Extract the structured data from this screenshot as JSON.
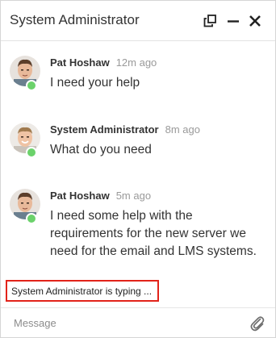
{
  "header": {
    "title": "System Administrator",
    "icons": [
      "popout-icon",
      "minimize-icon",
      "close-icon"
    ]
  },
  "messages": [
    {
      "sender": "Pat Hoshaw",
      "time": "12m ago",
      "text": "I need your help",
      "online": true
    },
    {
      "sender": "System Administrator",
      "time": "8m ago",
      "text": "What do you need",
      "online": true
    },
    {
      "sender": "Pat Hoshaw",
      "time": "5m ago",
      "text": "I need some help with the requirements for the new server we need for the email and LMS systems.",
      "online": true
    }
  ],
  "typing_indicator": "System Administrator is typing ...",
  "composer": {
    "placeholder": "Message",
    "attach_icon": "paperclip-icon"
  },
  "colors": {
    "online": "#6bd26b",
    "highlight_border": "#e2231a",
    "time_text": "#9a9a9a"
  }
}
